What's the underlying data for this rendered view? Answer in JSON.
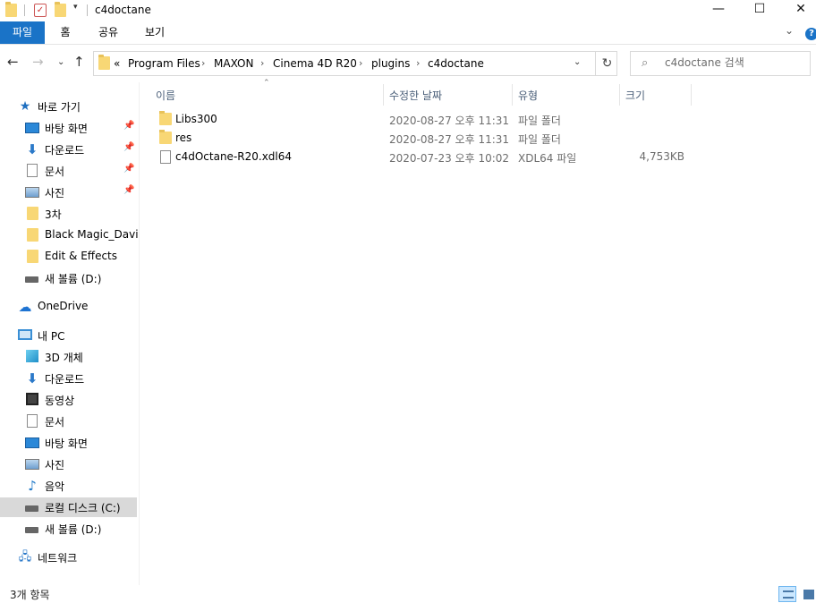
{
  "window": {
    "title": "c4doctane",
    "minimize_icon": "minimize-icon",
    "maximize_icon": "maximize-icon",
    "close_icon": "close-icon"
  },
  "ribbon": {
    "tabs": [
      "파일",
      "홈",
      "공유",
      "보기"
    ],
    "accent": "#1a73c7"
  },
  "address": {
    "prefix": "«",
    "crumbs": [
      "Program Files",
      "MAXON",
      "Cinema 4D R20",
      "plugins",
      "c4doctane"
    ]
  },
  "search": {
    "placeholder": "c4doctane 검색"
  },
  "sidebar": {
    "quick_access": {
      "label": "바로 가기",
      "items": [
        "바탕 화면",
        "다운로드",
        "문서",
        "사진",
        "3차",
        "Black Magic_Davinci",
        "Edit & Effects",
        "새 볼륨 (D:)"
      ]
    },
    "onedrive": "OneDrive",
    "this_pc": {
      "label": "내 PC",
      "items": [
        "3D 개체",
        "다운로드",
        "동영상",
        "문서",
        "바탕 화면",
        "사진",
        "음악",
        "로컬 디스크 (C:)",
        "새 볼륨 (D:)"
      ]
    },
    "network": "네트워크"
  },
  "columns": {
    "name": "이름",
    "date": "수정한 날짜",
    "type": "유형",
    "size": "크기"
  },
  "files": [
    {
      "name": "Libs300",
      "date": "2020-08-27 오후 11:31",
      "type": "파일 폴더",
      "size": "",
      "kind": "folder"
    },
    {
      "name": "res",
      "date": "2020-08-27 오후 11:31",
      "type": "파일 폴더",
      "size": "",
      "kind": "folder"
    },
    {
      "name": "c4dOctane-R20.xdl64",
      "date": "2020-07-23 오후 10:02",
      "type": "XDL64 파일",
      "size": "4,753KB",
      "kind": "file"
    }
  ],
  "status": {
    "item_count": "3개 항목"
  }
}
